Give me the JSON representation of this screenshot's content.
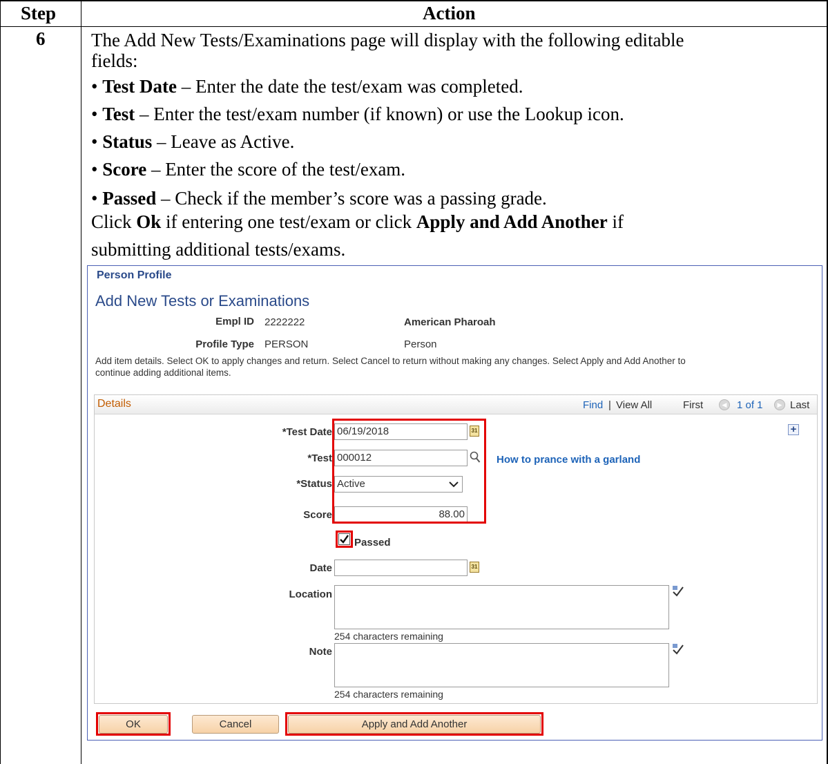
{
  "table": {
    "header_step": "Step",
    "header_action": "Action",
    "step_number": "6",
    "intro_line1": "The Add New Tests/Examinations page will display with the following editable",
    "intro_line2": "fields:",
    "bullets": [
      {
        "term": "Test Date",
        "desc": " – Enter the date the test/exam was completed."
      },
      {
        "term": "Test",
        "desc": " – Enter the test/exam number (if known) or use the Lookup icon."
      },
      {
        "term": "Status",
        "desc": " – Leave as Active."
      },
      {
        "term": "Score",
        "desc": " – Enter the score of the test/exam."
      },
      {
        "term": "Passed",
        "desc": " – Check if the member’s score was a passing grade."
      }
    ],
    "click_pre": "Click ",
    "click_ok": "Ok",
    "click_mid": " if entering one test/exam or click ",
    "click_apply": "Apply and Add Another",
    "click_post": " if",
    "click_line2": "submitting additional tests/exams."
  },
  "screen": {
    "breadcrumb": "Person Profile",
    "page_title": "Add New Tests or Examinations",
    "empl_id_label": "Empl ID",
    "empl_id_value": "2222222",
    "name_value": "American Pharoah",
    "profile_type_label": "Profile Type",
    "profile_type_value": "PERSON",
    "profile_type_desc": "Person",
    "instructions_line1": "Add item details. Select OK to apply changes and return. Select Cancel to return without making any changes. Select Apply and Add Another to",
    "instructions_line2": "continue adding additional items.",
    "details_title": "Details",
    "nav": {
      "find": "Find",
      "sep": "|",
      "view_all": "View All",
      "first": "First",
      "count": "1 of 1",
      "last": "Last"
    },
    "fields": {
      "test_date_label": "*Test Date",
      "test_date_value": "06/19/2018",
      "test_label": "*Test",
      "test_value": "000012",
      "test_desc": "How to prance with a garland",
      "status_label": "*Status",
      "status_value": "Active",
      "score_label": "Score",
      "score_value": "88.00",
      "passed_label": "Passed",
      "passed_checked": true,
      "date_label": "Date",
      "date_value": "",
      "location_label": "Location",
      "location_remaining": "254 characters remaining",
      "note_label": "Note",
      "note_remaining": "254 characters remaining"
    },
    "buttons": {
      "ok": "OK",
      "cancel": "Cancel",
      "apply": "Apply and Add Another"
    },
    "icons": {
      "calendar": "calendar-icon",
      "lookup": "magnifier-icon",
      "add": "plus-icon",
      "spell": "spellcheck-icon"
    }
  }
}
